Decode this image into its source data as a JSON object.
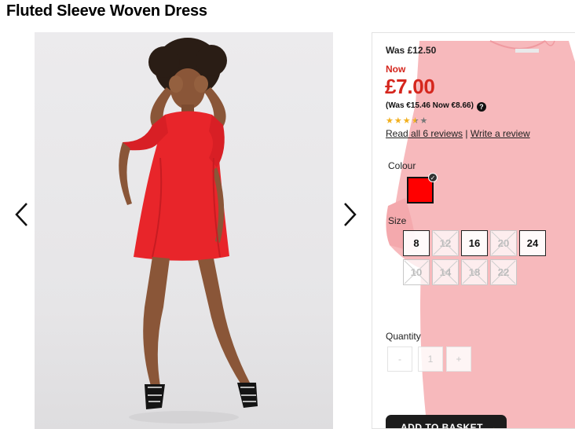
{
  "product": {
    "title": "Fluted Sleeve Woven Dress"
  },
  "gallery": {
    "prev_icon": "chevron-left-icon",
    "next_icon": "chevron-right-icon"
  },
  "pricing": {
    "was_price": "Was £12.50",
    "now_label": "Now",
    "current_price": "£7.00",
    "euro_price": "(Was €15.46 Now €8.66)",
    "price_color": "#d5261d"
  },
  "rating": {
    "value": 3.5,
    "max": 5,
    "read_reviews": "Read all 6 reviews",
    "separator": "|",
    "write_review": "Write a review"
  },
  "colour": {
    "label": "Colour",
    "selected_hex": "#ff0000"
  },
  "size": {
    "label": "Size",
    "options": [
      {
        "label": "8",
        "available": true
      },
      {
        "label": "12",
        "available": false
      },
      {
        "label": "16",
        "available": true
      },
      {
        "label": "20",
        "available": false
      },
      {
        "label": "24",
        "available": true
      },
      {
        "label": "10",
        "available": false
      },
      {
        "label": "14",
        "available": false
      },
      {
        "label": "18",
        "available": false
      },
      {
        "label": "22",
        "available": false
      }
    ]
  },
  "quantity": {
    "label": "Quantity",
    "minus": "-",
    "value": "1",
    "plus": "+"
  },
  "basket": {
    "label": "ADD TO BASKET",
    "arrow": "→"
  }
}
